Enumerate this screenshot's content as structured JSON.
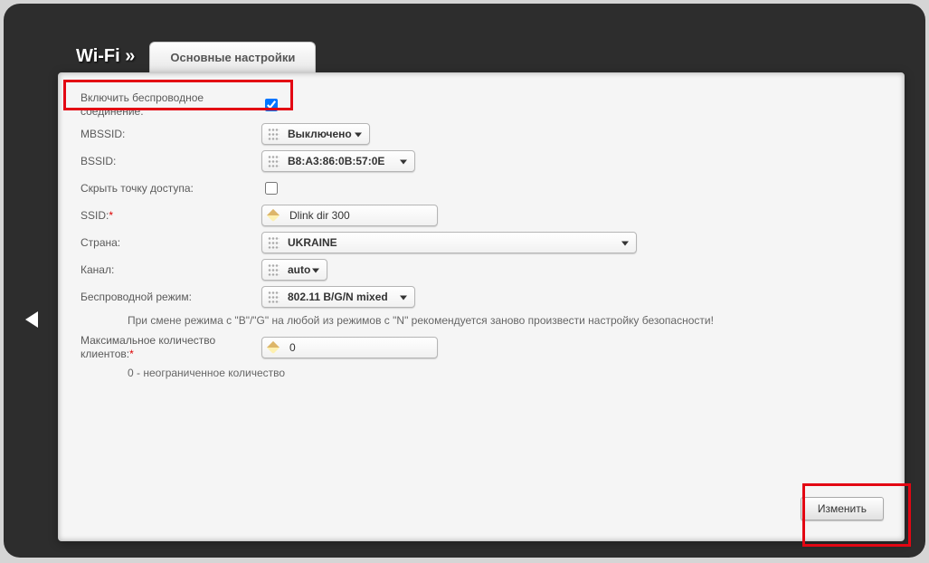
{
  "header": {
    "title": "Wi-Fi »",
    "tab": "Основные настройки"
  },
  "fields": {
    "enable_wireless_label": "Включить беспроводное соединение:",
    "enable_wireless_checked": true,
    "mbssid_label": "MBSSID:",
    "mbssid_value": "Выключено",
    "bssid_label": "BSSID:",
    "bssid_value": "B8:A3:86:0B:57:0E",
    "hide_ap_label": "Скрыть точку доступа:",
    "hide_ap_checked": false,
    "ssid_label": "SSID:",
    "ssid_value": "Dlink dir 300",
    "country_label": "Страна:",
    "country_value": "UKRAINE",
    "channel_label": "Канал:",
    "channel_value": "auto",
    "mode_label": "Беспроводной режим:",
    "mode_value": "802.11 B/G/N mixed",
    "mode_note": "При смене режима с \"B\"/\"G\" на любой из режимов с \"N\" рекомендуется заново произвести настройку безопасности!",
    "max_clients_label": "Максимальное количество клиентов:",
    "max_clients_value": "0",
    "max_clients_note": "0 - неограниченное количество"
  },
  "footer": {
    "apply": "Изменить"
  }
}
